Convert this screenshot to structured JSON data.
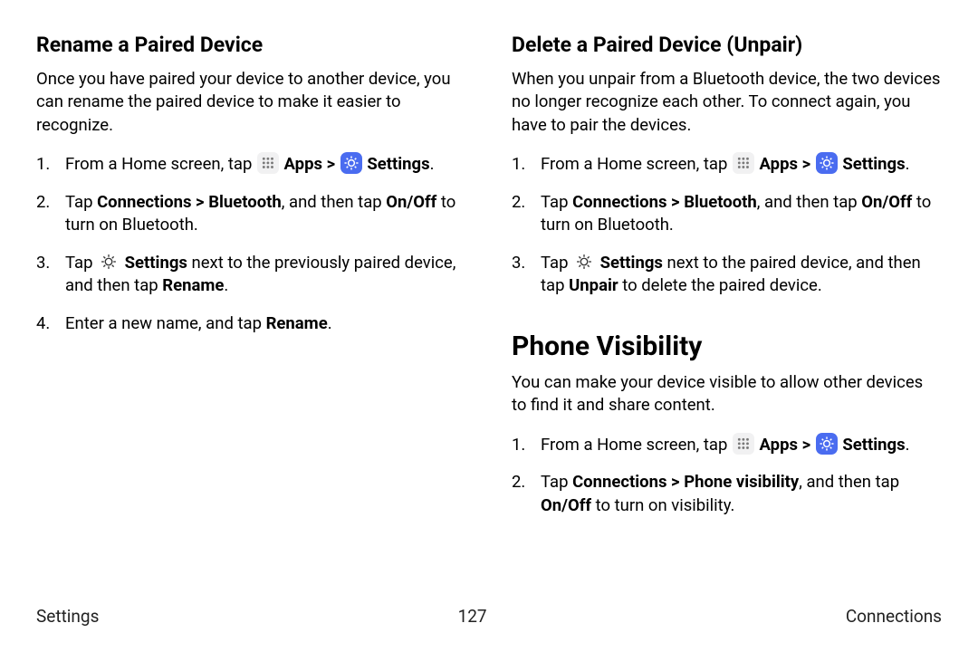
{
  "left": {
    "heading": "Rename a Paired Device",
    "intro": "Once you have paired your device to another device, you can rename the paired device to make it easier to recognize.",
    "steps": {
      "s1_a": "From a Home screen, tap ",
      "s1_apps": " Apps",
      "s1_gt": " > ",
      "s1_settings": " Settings",
      "s1_end": ".",
      "s2_a": "Tap ",
      "s2_b": "Connections > Bluetooth",
      "s2_c": ", and then tap ",
      "s2_d": "On/Off",
      "s2_e": " to turn on Bluetooth.",
      "s3_a": "Tap ",
      "s3_b": " Settings",
      "s3_c": " next to the previously paired device, and then tap ",
      "s3_d": "Rename",
      "s3_e": ".",
      "s4_a": "Enter a new name, and tap ",
      "s4_b": "Rename",
      "s4_c": "."
    }
  },
  "right_top": {
    "heading": "Delete a Paired Device (Unpair)",
    "intro": "When you unpair from a Bluetooth device, the two devices no longer recognize each other. To connect again, you have to pair the devices.",
    "steps": {
      "s1_a": "From a Home screen, tap ",
      "s1_apps": " Apps",
      "s1_gt": " > ",
      "s1_settings": " Settings",
      "s1_end": ".",
      "s2_a": "Tap ",
      "s2_b": "Connections > Bluetooth",
      "s2_c": ", and then tap ",
      "s2_d": "On/Off",
      "s2_e": " to turn on Bluetooth.",
      "s3_a": "Tap ",
      "s3_b": " Settings",
      "s3_c": " next to the paired device, and then tap ",
      "s3_d": "Unpair",
      "s3_e": " to delete the paired device."
    }
  },
  "right_bottom": {
    "heading": "Phone Visibility",
    "intro": "You can make your device visible to allow other devices to find it and share content.",
    "steps": {
      "s1_a": "From a Home screen, tap ",
      "s1_apps": " Apps",
      "s1_gt": " > ",
      "s1_settings": " Settings",
      "s1_end": ".",
      "s2_a": "Tap ",
      "s2_b": "Connections > Phone visibility",
      "s2_c": ", and then tap ",
      "s2_d": "On/Off",
      "s2_e": " to turn on visibility."
    }
  },
  "footer": {
    "left": "Settings",
    "center": "127",
    "right": "Connections"
  }
}
